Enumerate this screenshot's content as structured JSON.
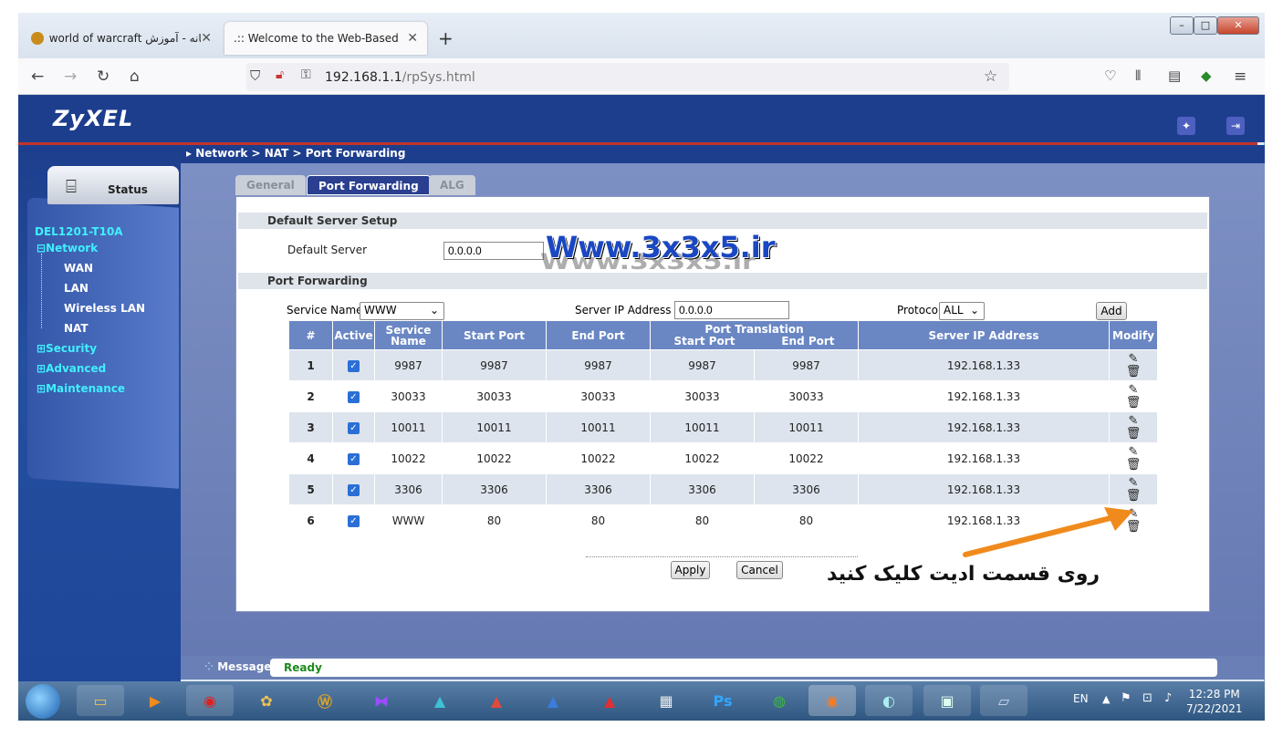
{
  "browser": {
    "tabs": [
      {
        "label": "world of warcraft خانه - آموزش"
      },
      {
        "label": ".:: Welcome to the Web-Based Confi"
      }
    ],
    "new_tab": "+",
    "url_host": "192.168.1.1",
    "url_path": "/rpSys.html",
    "window_buttons": {
      "minimize": "–",
      "maximize": "□",
      "close": "✕"
    }
  },
  "router": {
    "brand": "ZyXEL",
    "breadcrumb": "Network > NAT > Port Forwarding",
    "status_button": "Status",
    "device": "DEL1201-T10A",
    "menu": {
      "network": "Network",
      "wan": "WAN",
      "lan": "LAN",
      "wlan": "Wireless LAN",
      "nat": "NAT",
      "security": "Security",
      "advanced": "Advanced",
      "maintenance": "Maintenance"
    },
    "tabs": {
      "general": "General",
      "port_forwarding": "Port Forwarding",
      "alg": "ALG"
    },
    "default_server_section": "Default Server Setup",
    "default_server_label": "Default Server",
    "default_server_value": "0.0.0.0",
    "port_forwarding_section": "Port Forwarding",
    "form": {
      "service_name_label": "Service Name",
      "service_name_value": "WWW",
      "server_ip_label": "Server IP Address",
      "server_ip_value": "0.0.0.0",
      "protocol_label": "Protocol",
      "protocol_value": "ALL",
      "add_label": "Add"
    },
    "table": {
      "headers": {
        "num": "#",
        "active": "Active",
        "service_name": "Service Name",
        "start_port": "Start Port",
        "end_port": "End Port",
        "port_translation": "Port Translation",
        "pt_start": "Start Port",
        "pt_end": "End Port",
        "server_ip": "Server IP Address",
        "modify": "Modify"
      },
      "rows": [
        {
          "num": "1",
          "service": "9987",
          "start": "9987",
          "end": "9987",
          "pt_start": "9987",
          "pt_end": "9987",
          "ip": "192.168.1.33"
        },
        {
          "num": "2",
          "service": "30033",
          "start": "30033",
          "end": "30033",
          "pt_start": "30033",
          "pt_end": "30033",
          "ip": "192.168.1.33"
        },
        {
          "num": "3",
          "service": "10011",
          "start": "10011",
          "end": "10011",
          "pt_start": "10011",
          "pt_end": "10011",
          "ip": "192.168.1.33"
        },
        {
          "num": "4",
          "service": "10022",
          "start": "10022",
          "end": "10022",
          "pt_start": "10022",
          "pt_end": "10022",
          "ip": "192.168.1.33"
        },
        {
          "num": "5",
          "service": "3306",
          "start": "3306",
          "end": "3306",
          "pt_start": "3306",
          "pt_end": "3306",
          "ip": "192.168.1.33"
        },
        {
          "num": "6",
          "service": "WWW",
          "start": "80",
          "end": "80",
          "pt_start": "80",
          "pt_end": "80",
          "ip": "192.168.1.33"
        }
      ]
    },
    "apply_label": "Apply",
    "cancel_label": "Cancel",
    "message_label": "Message",
    "message_value": "Ready"
  },
  "overlay": {
    "watermark": "Www.3x3x5.ir",
    "watermark_shadow": "Www.3x3x5.ir",
    "annotation": "روی قسمت ادیت کلیک کنید"
  },
  "taskbar": {
    "lang": "EN",
    "time": "12:28 PM",
    "date": "7/22/2021"
  },
  "colors": {
    "zyxel_blue": "#1d3e8d",
    "header_cell": "#6a87c4",
    "row_shade": "#dde4ed",
    "accent_red": "#c2342b",
    "arrow_orange": "#f08a1c",
    "ready_green": "#1e8a1e"
  },
  "icons": [
    "back-icon",
    "forward-icon",
    "reload-icon",
    "home-icon",
    "shield-icon",
    "lock-icon",
    "key-icon",
    "star-icon",
    "pocket-icon",
    "library-icon",
    "sidebar-icon",
    "extension-icon",
    "menu-icon",
    "wizard-icon",
    "logout-icon",
    "router-icon",
    "edit-icon",
    "trash-icon"
  ]
}
